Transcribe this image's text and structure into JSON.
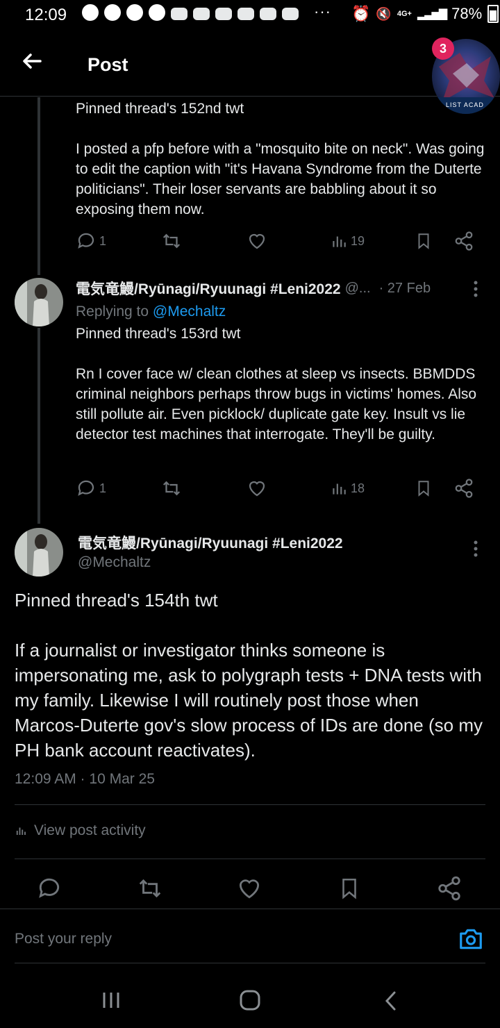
{
  "status_bar": {
    "time": "12:09",
    "dots": "···",
    "network": "4G+",
    "battery": "78%"
  },
  "header": {
    "title": "Post",
    "badge_count": "3",
    "avatar_label": "LIST ACAD"
  },
  "reply_152": {
    "text_line1": "Pinned thread's 152nd twt",
    "text_body": "I posted a pfp before with a \"mosquito bite on neck\". Was going to edit the caption with \"it's Havana Syndrome from the Duterte politicians\". Their loser servants are babbling about it so exposing them now.",
    "replies": "1",
    "views": "19"
  },
  "reply_153": {
    "name": "電気竜鰻/Ryūnagi/Ryuunagi #Leni2022",
    "handle": "@...",
    "date": "· 27 Feb",
    "replying_prefix": "Replying to",
    "replying_handle": "@Mechaltz",
    "text_line1": "Pinned thread's 153rd twt",
    "text_body": "Rn I cover face w/ clean clothes at sleep vs insects. BBMDDS criminal neighbors perhaps throw bugs in victims' homes. Also still pollute air. Even picklock/ duplicate gate key. Insult vs lie detector test machines that interrogate. They'll be guilty.",
    "replies": "1",
    "views": "18"
  },
  "main_post": {
    "name": "電気竜鰻/Ryūnagi/Ryuunagi #Leni2022",
    "handle": "@Mechaltz",
    "text_line1": "Pinned thread's 154th twt",
    "text_body": "If a journalist or investigator thinks someone is impersonating me, ask to polygraph tests + DNA tests with my family. Likewise I will routinely post those when Marcos-Duterte gov's slow process of IDs are done (so my PH bank account reactivates).",
    "timestamp": "12:09 AM · 10 Mar 25",
    "view_activity": "View post activity"
  },
  "composer": {
    "placeholder": "Post your reply"
  },
  "colors": {
    "background": "#000000",
    "text": "#e7e9ea",
    "muted": "#71767b",
    "accent": "#1d9bf0",
    "badge": "#e0245e",
    "divider": "#2f3336"
  }
}
